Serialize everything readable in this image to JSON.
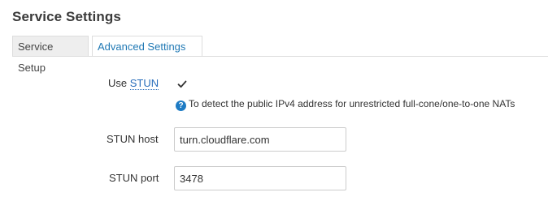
{
  "page": {
    "title": "Service Settings"
  },
  "tabs": [
    {
      "label": "Service Setup",
      "active": false
    },
    {
      "label": "Advanced Settings",
      "active": true
    }
  ],
  "form": {
    "use_stun": {
      "label_prefix": "Use ",
      "label_abbr": "STUN",
      "checked": true,
      "help_text": "To detect the public IPv4 address for unrestricted full-cone/one-to-one NATs",
      "help_icon": "?"
    },
    "stun_host": {
      "label": "STUN host",
      "value": "turn.cloudflare.com"
    },
    "stun_port": {
      "label": "STUN port",
      "value": "3478"
    }
  },
  "colors": {
    "tab_active_text": "#1f78b4",
    "help_icon_bg": "#1d7bc4",
    "abbr_link": "#2a6ebb"
  },
  "icons": {
    "checkbox_check": "check-icon",
    "help": "question-circle-icon"
  }
}
